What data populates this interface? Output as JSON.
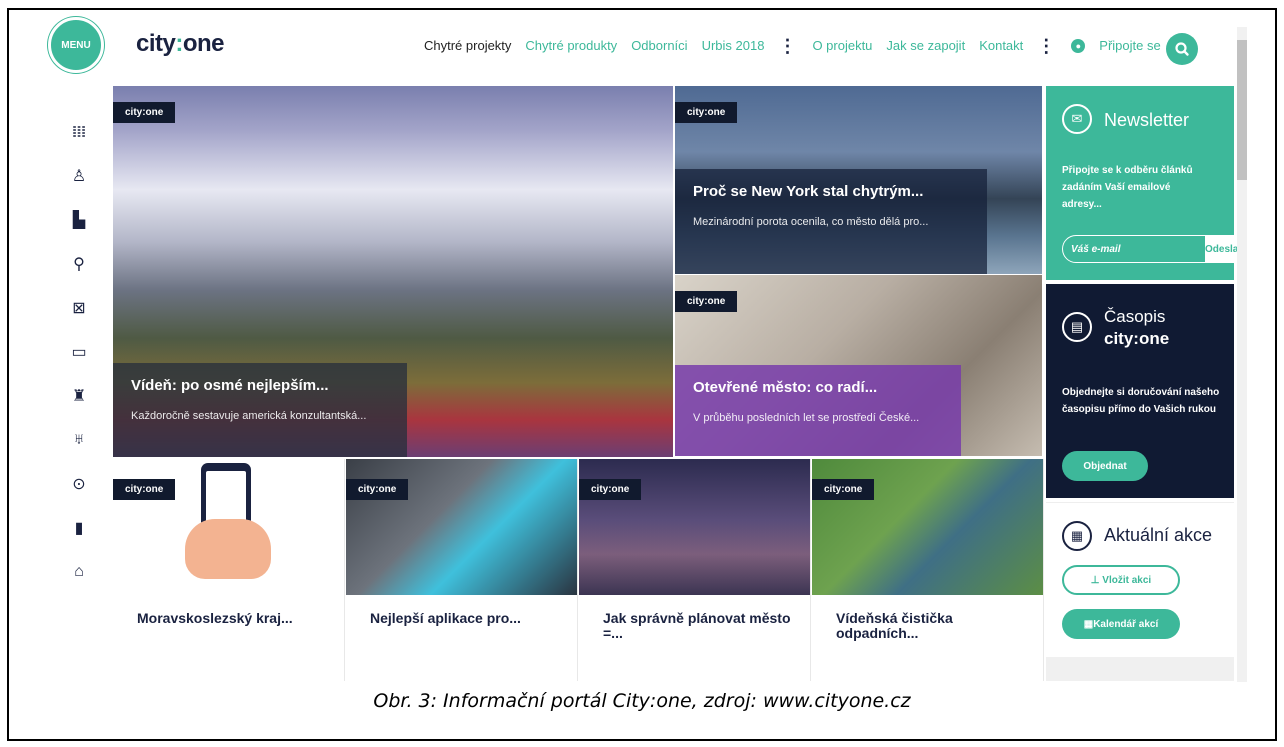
{
  "header": {
    "menu_label": "MENU",
    "logo_prefix": "city",
    "logo_colon": ":",
    "logo_suffix": "one",
    "nav": [
      "Chytré projekty",
      "Chytré produkty",
      "Odborníci",
      "Urbis 2018",
      "O projektu",
      "Jak se zapojit",
      "Kontakt"
    ],
    "join_label": "Připojte se"
  },
  "iconbar": [
    "columns-icon",
    "person-icon",
    "buildings-icon",
    "bicycle-icon",
    "network-icon",
    "devices-icon",
    "tree-icon",
    "trophy-icon",
    "location-pin-icon",
    "bar-chart-icon",
    "home-icon"
  ],
  "tag": "city:one",
  "hero": {
    "main": {
      "title": "Vídeň: po osmé nejlepším...",
      "excerpt": "Každoročně sestavuje americká konzultantská..."
    },
    "ny": {
      "title": "Proč se New York stal chytrým...",
      "excerpt": "Mezinárodní porota ocenila, co město dělá pro..."
    },
    "open": {
      "title": "Otevřené město: co radí...",
      "excerpt": "V průběhu posledních let se prostředí České..."
    }
  },
  "cards": [
    {
      "title": "Moravskoslezský kraj..."
    },
    {
      "title": "Nejlepší aplikace pro..."
    },
    {
      "title": "Jak správně plánovat město =..."
    },
    {
      "title": "Vídeňská čistička odpadních..."
    }
  ],
  "newsletter": {
    "title": "Newsletter",
    "text": "Připojte se k odběru článků zadáním Vaší emailové adresy...",
    "placeholder": "Váš e-mail",
    "send": "Odeslat"
  },
  "magazine": {
    "title": "Časopis",
    "brand": "city:one",
    "text": "Objednejte si doručování našeho časopisu přímo do Vašich rukou",
    "order": "Objednat"
  },
  "events": {
    "title": "Aktuální akce",
    "add": "Vložit akci",
    "calendar": "Kalendář akcí"
  },
  "caption": "Obr. 3: Informační portál City:one, zdroj: www.cityone.cz",
  "colors": {
    "accent": "#3db89a",
    "navy": "#101a33",
    "purple": "#7c3caa"
  }
}
